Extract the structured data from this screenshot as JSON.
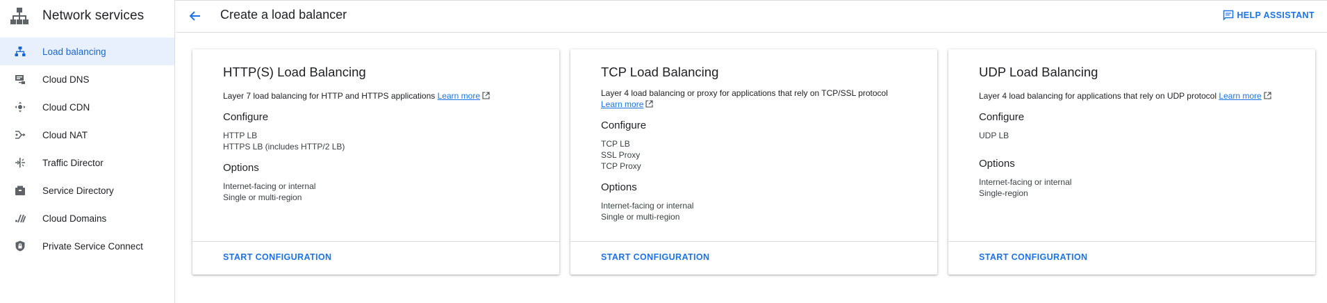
{
  "app": {
    "title": "Network services"
  },
  "sidebar": {
    "items": [
      {
        "label": "Load balancing",
        "icon": "load-balancing-icon",
        "active": true
      },
      {
        "label": "Cloud DNS",
        "icon": "dns-icon"
      },
      {
        "label": "Cloud CDN",
        "icon": "cdn-icon"
      },
      {
        "label": "Cloud NAT",
        "icon": "nat-icon"
      },
      {
        "label": "Traffic Director",
        "icon": "traffic-director-icon"
      },
      {
        "label": "Service Directory",
        "icon": "service-directory-icon"
      },
      {
        "label": "Cloud Domains",
        "icon": "domains-icon"
      },
      {
        "label": "Private Service Connect",
        "icon": "private-service-connect-icon"
      }
    ]
  },
  "header": {
    "title": "Create a load balancer",
    "help_label": "HELP ASSISTANT"
  },
  "cards": [
    {
      "title": "HTTP(S) Load Balancing",
      "description": "Layer 7 load balancing for HTTP and HTTPS applications",
      "learn_more": "Learn more",
      "configure_heading": "Configure",
      "configure": [
        "HTTP LB",
        "HTTPS LB (includes HTTP/2 LB)"
      ],
      "options_heading": "Options",
      "options": [
        "Internet-facing or internal",
        "Single or multi-region"
      ],
      "action": "START CONFIGURATION"
    },
    {
      "title": "TCP Load Balancing",
      "description": "Layer 4 load balancing or proxy for applications that rely on TCP/SSL protocol",
      "learn_more": "Learn more",
      "configure_heading": "Configure",
      "configure": [
        "TCP LB",
        "SSL Proxy",
        "TCP Proxy"
      ],
      "options_heading": "Options",
      "options": [
        "Internet-facing or internal",
        "Single or multi-region"
      ],
      "action": "START CONFIGURATION"
    },
    {
      "title": "UDP Load Balancing",
      "description": "Layer 4 load balancing for applications that rely on UDP protocol",
      "learn_more": "Learn more",
      "configure_heading": "Configure",
      "configure": [
        "UDP LB"
      ],
      "options_heading": "Options",
      "options": [
        "Internet-facing or internal",
        "Single-region"
      ],
      "action": "START CONFIGURATION"
    }
  ],
  "colors": {
    "accent": "#1a73e8",
    "active_bg": "#e8f0fe",
    "active_text": "#1967d2",
    "icon": "#5f6368"
  }
}
